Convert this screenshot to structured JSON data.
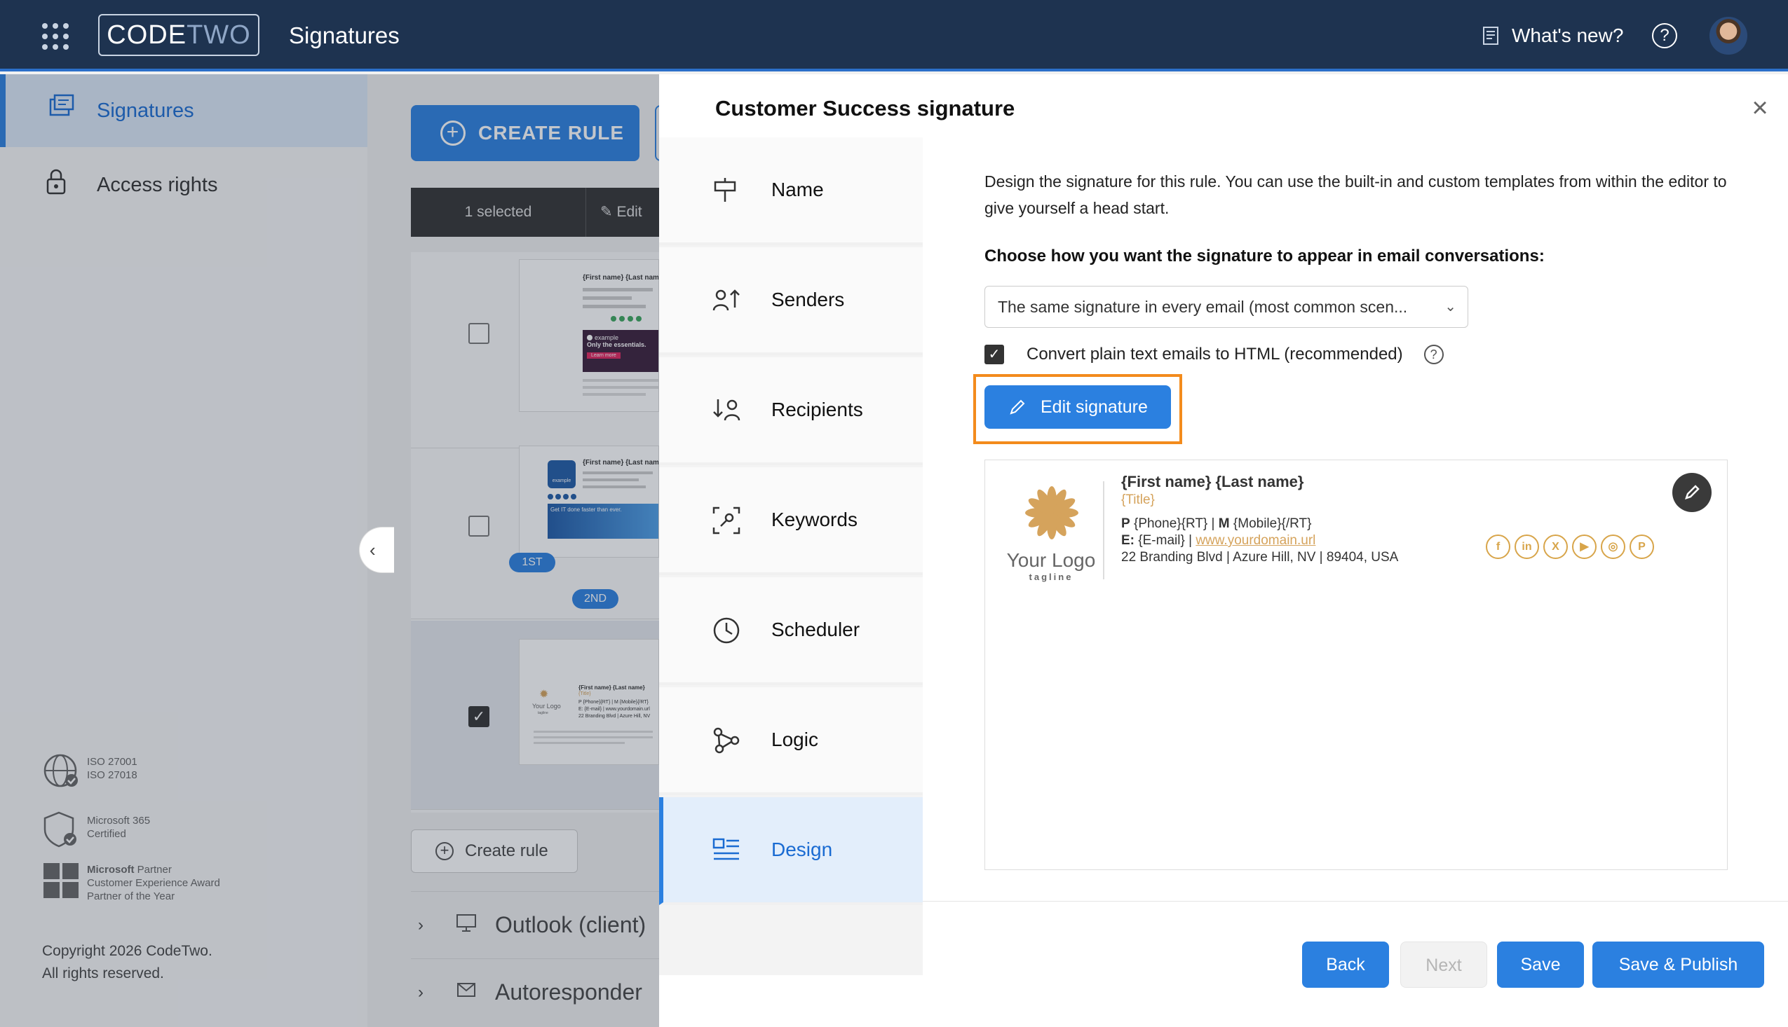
{
  "topbar": {
    "brand_code": "CODE",
    "brand_two": "TWO",
    "app_title": "Signatures",
    "whats_new": "What's new?",
    "help": "?"
  },
  "leftnav": {
    "items": [
      {
        "label": "Signatures",
        "active": true
      },
      {
        "label": "Access rights",
        "active": false
      }
    ],
    "certs": [
      {
        "line1": "ISO 27001",
        "line2": "ISO 27018"
      },
      {
        "line1": "Microsoft 365",
        "line2": "Certified"
      },
      {
        "line1_bold": "Microsoft",
        "line1_rest": "Partner",
        "line2": "Customer Experience Award",
        "line3": "Partner of the Year"
      }
    ],
    "copyright_1": "Copyright 2026 CodeTwo.",
    "copyright_2": "All rights reserved."
  },
  "middle": {
    "create_rule": "CREATE RULE",
    "selected": "1 selected",
    "edit": "Edit",
    "badges": [
      "1ST",
      "2ND"
    ],
    "create_rule_link": "Create rule",
    "groups": [
      "Outlook (client)",
      "Autoresponder"
    ],
    "collapse": "‹",
    "thumb1": {
      "name": "{First name} {Last name}",
      "promo_brand": "example",
      "promo_text": "Only the essentials.",
      "promo_button": "Learn more"
    },
    "thumb2": {
      "name": "{First name} {Last name}",
      "brand": "example",
      "promo_text": "Get IT done faster than ever."
    },
    "thumb3": {
      "logo": "Your Logo",
      "tagline": "tagline",
      "name": "{First name} {Last name}",
      "title": "{Title}",
      "line1": "P {Phone}{RT} | M {Mobile}{/RT}",
      "line2": "E: {E-mail} | www.yourdomain.url",
      "line3": "22 Branding Blvd | Azure Hill, NV"
    }
  },
  "dialog": {
    "title": "Customer Success signature",
    "close": "×",
    "steps": [
      {
        "label": "Name",
        "icon": "signpost-icon"
      },
      {
        "label": "Senders",
        "icon": "senders-icon"
      },
      {
        "label": "Recipients",
        "icon": "recipients-icon"
      },
      {
        "label": "Keywords",
        "icon": "keywords-icon"
      },
      {
        "label": "Scheduler",
        "icon": "clock-icon"
      },
      {
        "label": "Logic",
        "icon": "logic-icon"
      },
      {
        "label": "Design",
        "icon": "design-icon",
        "active": true
      }
    ],
    "description": "Design the signature for this rule. You can use the built-in and custom templates from within the editor to give yourself a head start.",
    "choose_label": "Choose how you want the signature to appear in email conversations:",
    "select_value": "The same signature in every email (most common scen...",
    "convert_label": "Convert plain text emails to HTML (recommended)",
    "help": "?",
    "edit_signature": "Edit signature",
    "signature": {
      "logo_text": "Your Logo",
      "tagline": "tagline",
      "name": "{First name} {Last name}",
      "title": "{Title}",
      "p_label": "P",
      "phone": "{Phone}{RT} |",
      "m_label": "M",
      "mobile": "{Mobile}{/RT}",
      "e_label": "E:",
      "email": "{E-mail} |",
      "url": "www.yourdomain.url",
      "address": "22 Branding Blvd | Azure Hill, NV | 89404, USA",
      "social": [
        "f",
        "in",
        "X",
        "▶",
        "◎",
        "P"
      ]
    },
    "buttons": {
      "back": "Back",
      "next": "Next",
      "save": "Save",
      "save_publish": "Save & Publish"
    }
  },
  "colors": {
    "topbar": "#1e3350",
    "accent": "#2b80e0",
    "highlight": "#f38b1c",
    "signature_gold": "#d5a35c"
  }
}
